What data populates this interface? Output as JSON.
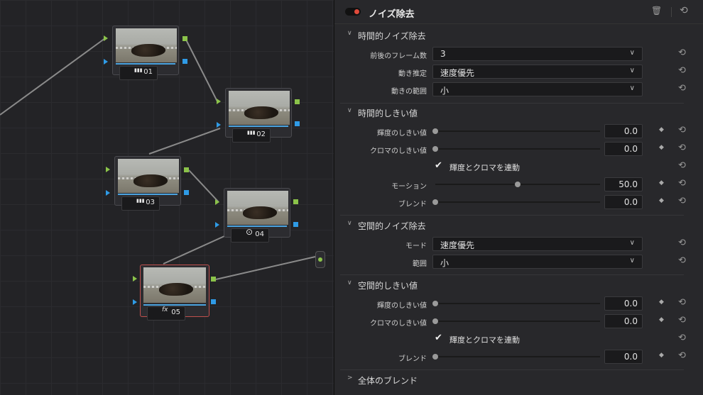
{
  "nodes": [
    {
      "id": "01",
      "badge": "▮▮▮",
      "badge_icon": "bars-icon"
    },
    {
      "id": "02",
      "badge": "▮▮▮",
      "badge_icon": "bars-icon"
    },
    {
      "id": "03",
      "badge": "▮▮▮",
      "badge_icon": "bars-icon"
    },
    {
      "id": "04",
      "badge": "⊙",
      "badge_icon": "circle-dot-icon"
    },
    {
      "id": "05",
      "badge": "fx",
      "badge_icon": "fx-icon"
    }
  ],
  "panel": {
    "title": "ノイズ除去",
    "delete_icon": "🗑",
    "reset_icon": "⟲",
    "sections": {
      "temporal": {
        "label": "時間的ノイズ除去",
        "frames_label": "前後のフレーム数",
        "frames_value": "3",
        "motion_est_label": "動き推定",
        "motion_est_value": "速度優先",
        "motion_range_label": "動きの範囲",
        "motion_range_value": "小"
      },
      "temporal_threshold": {
        "label": "時間的しきい値",
        "luma_label": "輝度のしきい値",
        "luma_value": "0.0",
        "luma_level": 0,
        "chroma_label": "クロマのしきい値",
        "chroma_value": "0.0",
        "chroma_level": 0,
        "link_label": "輝度とクロマを連動",
        "link_checked": true,
        "motion_label": "モーション",
        "motion_value": "50.0",
        "motion_level": 0.5,
        "blend_label": "ブレンド",
        "blend_value": "0.0",
        "blend_level": 0
      },
      "spatial": {
        "label": "空間的ノイズ除去",
        "mode_label": "モード",
        "mode_value": "速度優先",
        "range_label": "範囲",
        "range_value": "小"
      },
      "spatial_threshold": {
        "label": "空間的しきい値",
        "luma_label": "輝度のしきい値",
        "luma_value": "0.0",
        "luma_level": 0,
        "chroma_label": "クロマのしきい値",
        "chroma_value": "0.0",
        "chroma_level": 0,
        "link_label": "輝度とクロマを連動",
        "link_checked": true,
        "blend_label": "ブレンド",
        "blend_value": "0.0",
        "blend_level": 0
      },
      "global_blend": {
        "label": "全体のブレンド"
      }
    }
  },
  "colors": {
    "accent_blue": "#2f9be6",
    "port_green": "#8bc34a",
    "selected_border": "#c0504d",
    "toggle_red": "#e04a3b"
  }
}
